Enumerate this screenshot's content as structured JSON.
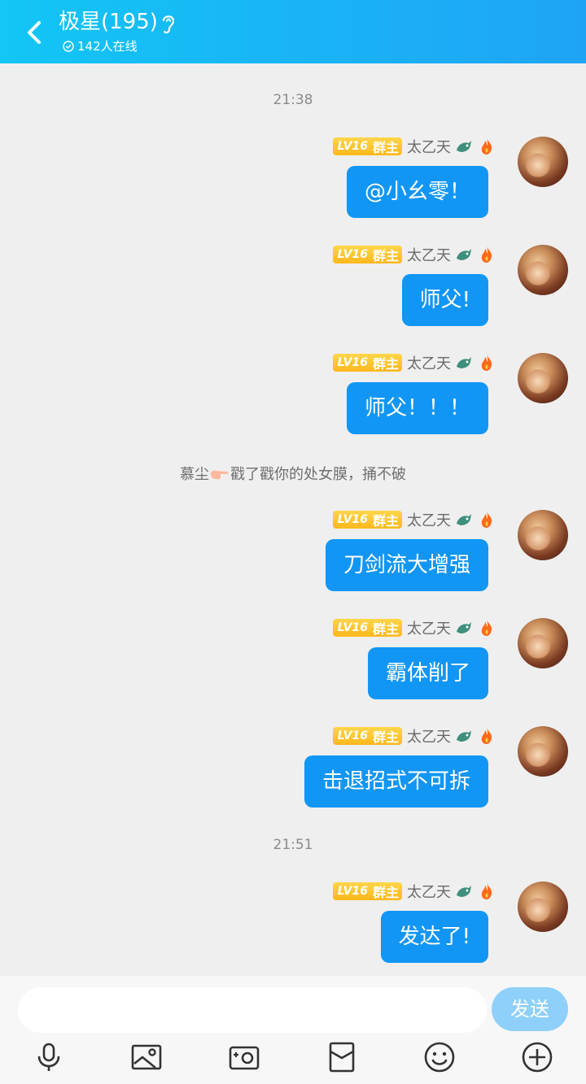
{
  "header": {
    "title": "极星(195)",
    "online": "142人在线",
    "background": "#19b4f6"
  },
  "timestamps": [
    "21:38",
    "21:51"
  ],
  "system_message": {
    "prefix": "慕尘",
    "suffix": "戳了戳你的处女膜，捅不破"
  },
  "sender": {
    "level": "LV16",
    "role": "群主",
    "nickname": "太乙天"
  },
  "messages": [
    {
      "text": "@小幺零！"
    },
    {
      "text": "师父!"
    },
    {
      "text": "师父！！！"
    },
    {
      "text": "刀剑流大增强"
    },
    {
      "text": "霸体削了"
    },
    {
      "text": "击退招式不可拆"
    },
    {
      "text": "发达了!"
    }
  ],
  "composer": {
    "placeholder": "",
    "send_label": "发送"
  },
  "toolbar_icons": [
    "microphone-icon",
    "image-icon",
    "camera-icon",
    "red-packet-icon",
    "emoji-icon",
    "plus-icon"
  ],
  "colors": {
    "bubble": "#1296f5",
    "send_button": "#8fd0fb",
    "level_badge": "#ffc52a"
  }
}
